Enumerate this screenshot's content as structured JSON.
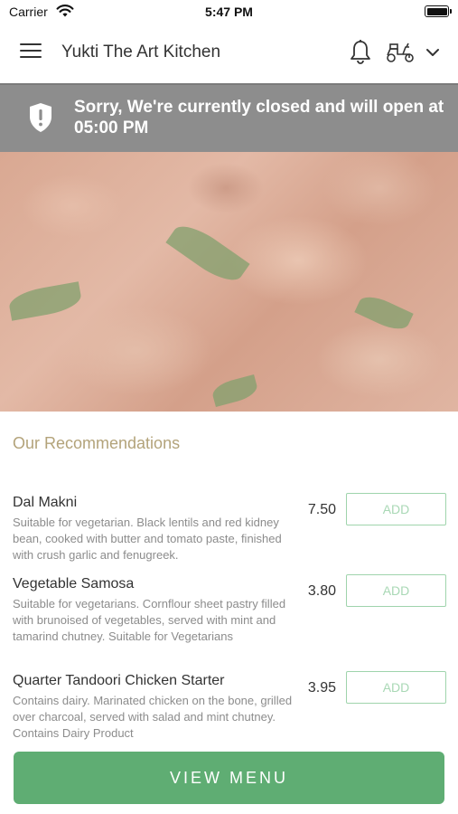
{
  "status_bar": {
    "carrier": "Carrier",
    "time": "5:47 PM"
  },
  "header": {
    "restaurant_name": "Yukti The Art Kitchen"
  },
  "banner": {
    "message": "Sorry, We're currently closed and will open at 05:00 PM"
  },
  "section": {
    "title": "Our Recommendations"
  },
  "items": [
    {
      "name": "Dal Makni",
      "description": "Suitable for vegetarian. Black lentils and red kidney bean, cooked with butter and tomato paste, finished with crush garlic and fenugreek.",
      "price": "7.50",
      "add_label": "ADD"
    },
    {
      "name": "Vegetable Samosa",
      "description": "Suitable for vegetarians. Cornflour sheet pastry filled with brunoised of vegetables, served with mint and tamarind chutney. Suitable for Vegetarians",
      "price": "3.80",
      "add_label": "ADD"
    },
    {
      "name": "Quarter Tandoori Chicken Starter",
      "description": "Contains dairy. Marinated chicken on the bone, grilled over charcoal, served with salad and mint chutney. Contains Dairy Product",
      "price": "3.95",
      "add_label": "ADD"
    }
  ],
  "view_menu_label": "VIEW MENU",
  "colors": {
    "accent_green": "#5fad73",
    "banner_gray": "#8d8d8d",
    "section_title": "#b3a37a"
  },
  "icons": {
    "menu": "hamburger-icon",
    "notifications": "bell-icon",
    "delivery": "scooter-icon",
    "expand": "chevron-down-icon",
    "closed": "shield-alert-icon",
    "wifi": "wifi-icon",
    "battery": "battery-icon"
  }
}
